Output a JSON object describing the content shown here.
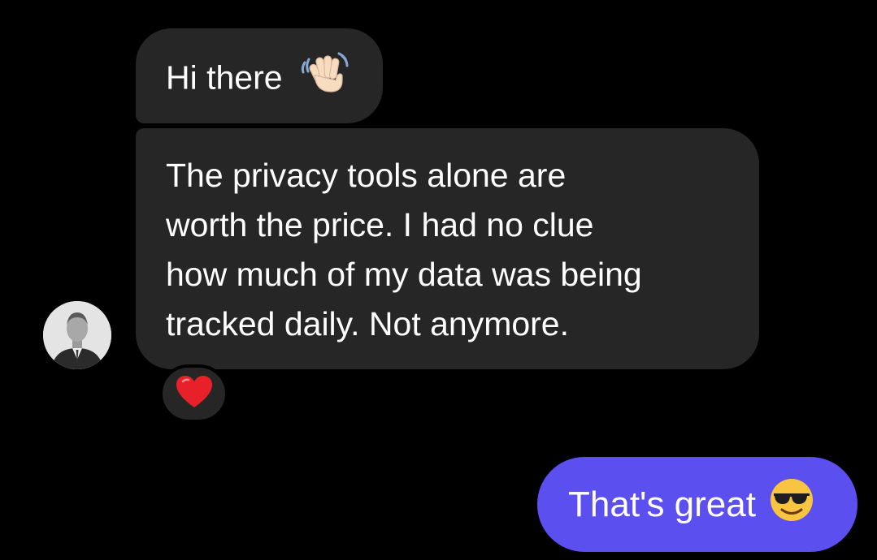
{
  "messages": {
    "incoming_1": {
      "text": "Hi there",
      "emoji": "waving-hand"
    },
    "incoming_2": {
      "text": "The privacy tools alone are\nworth the price. I had no clue\nhow much of my data was being\ntracked daily. Not anymore."
    },
    "reaction": {
      "emoji": "red-heart"
    },
    "outgoing_1": {
      "text": "That's great",
      "emoji": "smiling-face-with-sunglasses"
    }
  },
  "colors": {
    "background": "#000000",
    "incoming_bubble": "#262626",
    "outgoing_bubble": "#5b4ff0",
    "text": "#ffffff"
  }
}
